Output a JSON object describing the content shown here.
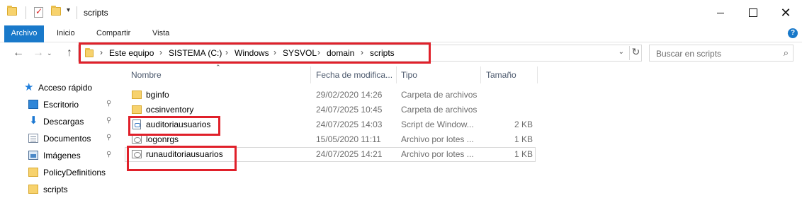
{
  "window": {
    "title": "scripts",
    "quick_access_dropdown": "▾",
    "minimize_label": "",
    "maximize_label": "",
    "close_label": "✕"
  },
  "ribbon": {
    "tabs": [
      "Archivo",
      "Inicio",
      "Compartir",
      "Vista"
    ],
    "accent": "#1979ca",
    "expand_icon": "chevron-down-icon",
    "help_label": "?"
  },
  "nav": {
    "back": "←",
    "forward": "→",
    "recent": "⌄",
    "up": "↑",
    "breadcrumb": [
      "Este equipo",
      "SISTEMA (C:)",
      "Windows",
      "SYSVOL",
      "domain",
      "scripts"
    ],
    "separator": "›",
    "refresh": "↻",
    "search_placeholder": "Buscar en scripts"
  },
  "sidebar": {
    "items": [
      {
        "label": "Acceso rápido",
        "icon": "star-icon",
        "pinned": false
      },
      {
        "label": "Escritorio",
        "icon": "desktop-icon",
        "pinned": true
      },
      {
        "label": "Descargas",
        "icon": "download-icon",
        "pinned": true
      },
      {
        "label": "Documentos",
        "icon": "documents-icon",
        "pinned": true
      },
      {
        "label": "Imágenes",
        "icon": "pictures-icon",
        "pinned": true
      },
      {
        "label": "PolicyDefinitions",
        "icon": "folder-icon",
        "pinned": false
      },
      {
        "label": "scripts",
        "icon": "folder-icon",
        "pinned": false
      }
    ],
    "pin_glyph": "📌"
  },
  "files": {
    "columns": [
      "Nombre",
      "Fecha de modifica...",
      "Tipo",
      "Tamaño"
    ],
    "rows": [
      {
        "name": "bginfo",
        "date": "29/02/2020 14:26",
        "type": "Carpeta de archivos",
        "size": "",
        "icon": "folder-icon"
      },
      {
        "name": "ocsinventory",
        "date": "24/07/2025 10:45",
        "type": "Carpeta de archivos",
        "size": "",
        "icon": "folder-icon"
      },
      {
        "name": "auditoriausuarios",
        "date": "24/07/2025 14:03",
        "type": "Script de Window...",
        "size": "2 KB",
        "icon": "script-icon"
      },
      {
        "name": "logonrgs",
        "date": "15/05/2020 11:11",
        "type": "Archivo por lotes ...",
        "size": "1 KB",
        "icon": "batch-file-icon"
      },
      {
        "name": "runauditoriausuarios",
        "date": "24/07/2025 14:21",
        "type": "Archivo por lotes ...",
        "size": "1 KB",
        "icon": "batch-file-icon"
      }
    ]
  },
  "highlight_color": "#e0202a"
}
